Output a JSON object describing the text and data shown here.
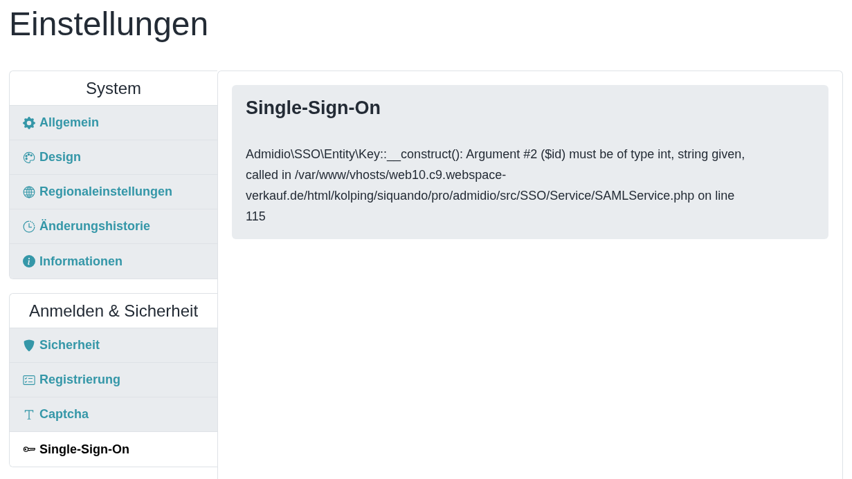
{
  "page_title": "Einstellungen",
  "sidebar": {
    "groups": [
      {
        "title": "System",
        "items": [
          {
            "label": "Allgemein",
            "selected": false
          },
          {
            "label": "Design",
            "selected": false
          },
          {
            "label": "Regionaleinstellungen",
            "selected": false
          },
          {
            "label": "Änderungshistorie",
            "selected": false
          },
          {
            "label": "Informationen",
            "selected": false
          }
        ]
      },
      {
        "title": "Anmelden & Sicherheit",
        "items": [
          {
            "label": "Sicherheit",
            "selected": false
          },
          {
            "label": "Registrierung",
            "selected": false
          },
          {
            "label": "Captcha",
            "selected": false
          },
          {
            "label": "Single-Sign-On",
            "selected": true
          }
        ]
      }
    ]
  },
  "content": {
    "heading": "Single-Sign-On",
    "message": "Admidio\\SSO\\Entity\\Key::__construct(): Argument #2 ($id) must be of type int, string given, called in /var/www/vhosts/web10.c9.webspace-verkauf.de/html/kolping/siquando/pro/admidio/src/SSO/Service/SAMLService.php on line 115"
  }
}
